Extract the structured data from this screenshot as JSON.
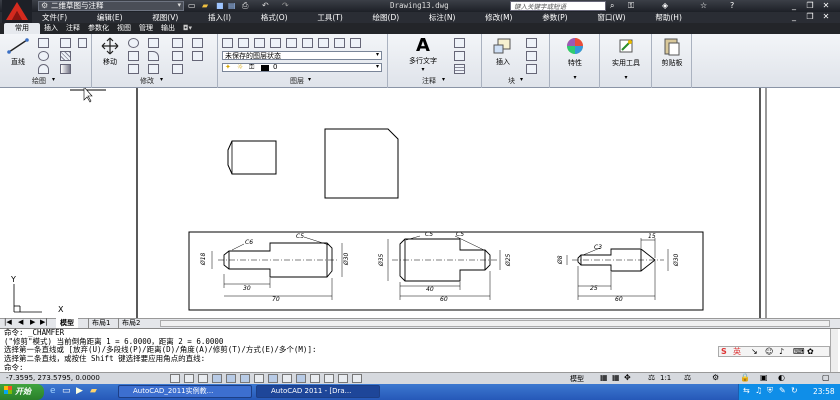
{
  "title": {
    "workspace": "二维草图与注释",
    "filename": "Drawing13.dwg",
    "search_placeholder": "键入关键字或短语"
  },
  "menu": [
    "文件(F)",
    "编辑(E)",
    "视图(V)",
    "插入(I)",
    "格式(O)",
    "工具(T)",
    "绘图(D)",
    "标注(N)",
    "修改(M)",
    "参数(P)",
    "窗口(W)",
    "帮助(H)"
  ],
  "ribbon_tabs": [
    "常用",
    "插入",
    "注释",
    "参数化",
    "视图",
    "管理",
    "输出"
  ],
  "ribbon": {
    "line_label": "直线",
    "move_label": "移动",
    "layer_state": "未保存的图层状态",
    "layer_value": "0",
    "mtext_label": "多行文字",
    "insert_label": "插入",
    "properties_label": "特性",
    "utilities_label": "实用工具",
    "clipboard_label": "剪贴板",
    "groups": [
      "绘图",
      "修改",
      "图层",
      "注释",
      "块"
    ]
  },
  "drawing": {
    "dims_part1": {
      "d1": "Ø18",
      "d2": "Ø30",
      "c1": "C6",
      "c2": "C5",
      "l1": "30",
      "l2": "70"
    },
    "dims_part2": {
      "d1": "Ø35",
      "d2": "Ø25",
      "c1": "C5",
      "c2": "C5",
      "l1": "40",
      "l2": "60"
    },
    "dims_part3": {
      "d1": "Ø8",
      "d2": "Ø30",
      "c1": "C3",
      "c2": "15",
      "l1": "25",
      "l2": "60"
    },
    "ucs": {
      "x": "X",
      "y": "Y"
    }
  },
  "layout_tabs": [
    "模型",
    "布局1",
    "布局2"
  ],
  "command": {
    "lines": [
      "命令:  _CHAMFER",
      "(\"修剪\"模式) 当前倒角距离 1 = 6.0000，距离 2 = 6.0000",
      "选择第一条直线或 [放弃(U)/多段线(P)/距离(D)/角度(A)/修剪(T)/方式(E)/多个(M)]:",
      "选择第二条直线，或按住 Shift 键选择要应用角点的直线:"
    ],
    "prompt": "命令:",
    "ime": "英"
  },
  "status": {
    "coords": "-7.3595, 273.5795, 0.0000",
    "model": "模型",
    "scale": "1:1"
  },
  "taskbar": {
    "start": "开始",
    "tasks": [
      "AutoCAD_2011实例教...",
      "AutoCAD 2011 - [Dra..."
    ],
    "clock": "23:58"
  }
}
